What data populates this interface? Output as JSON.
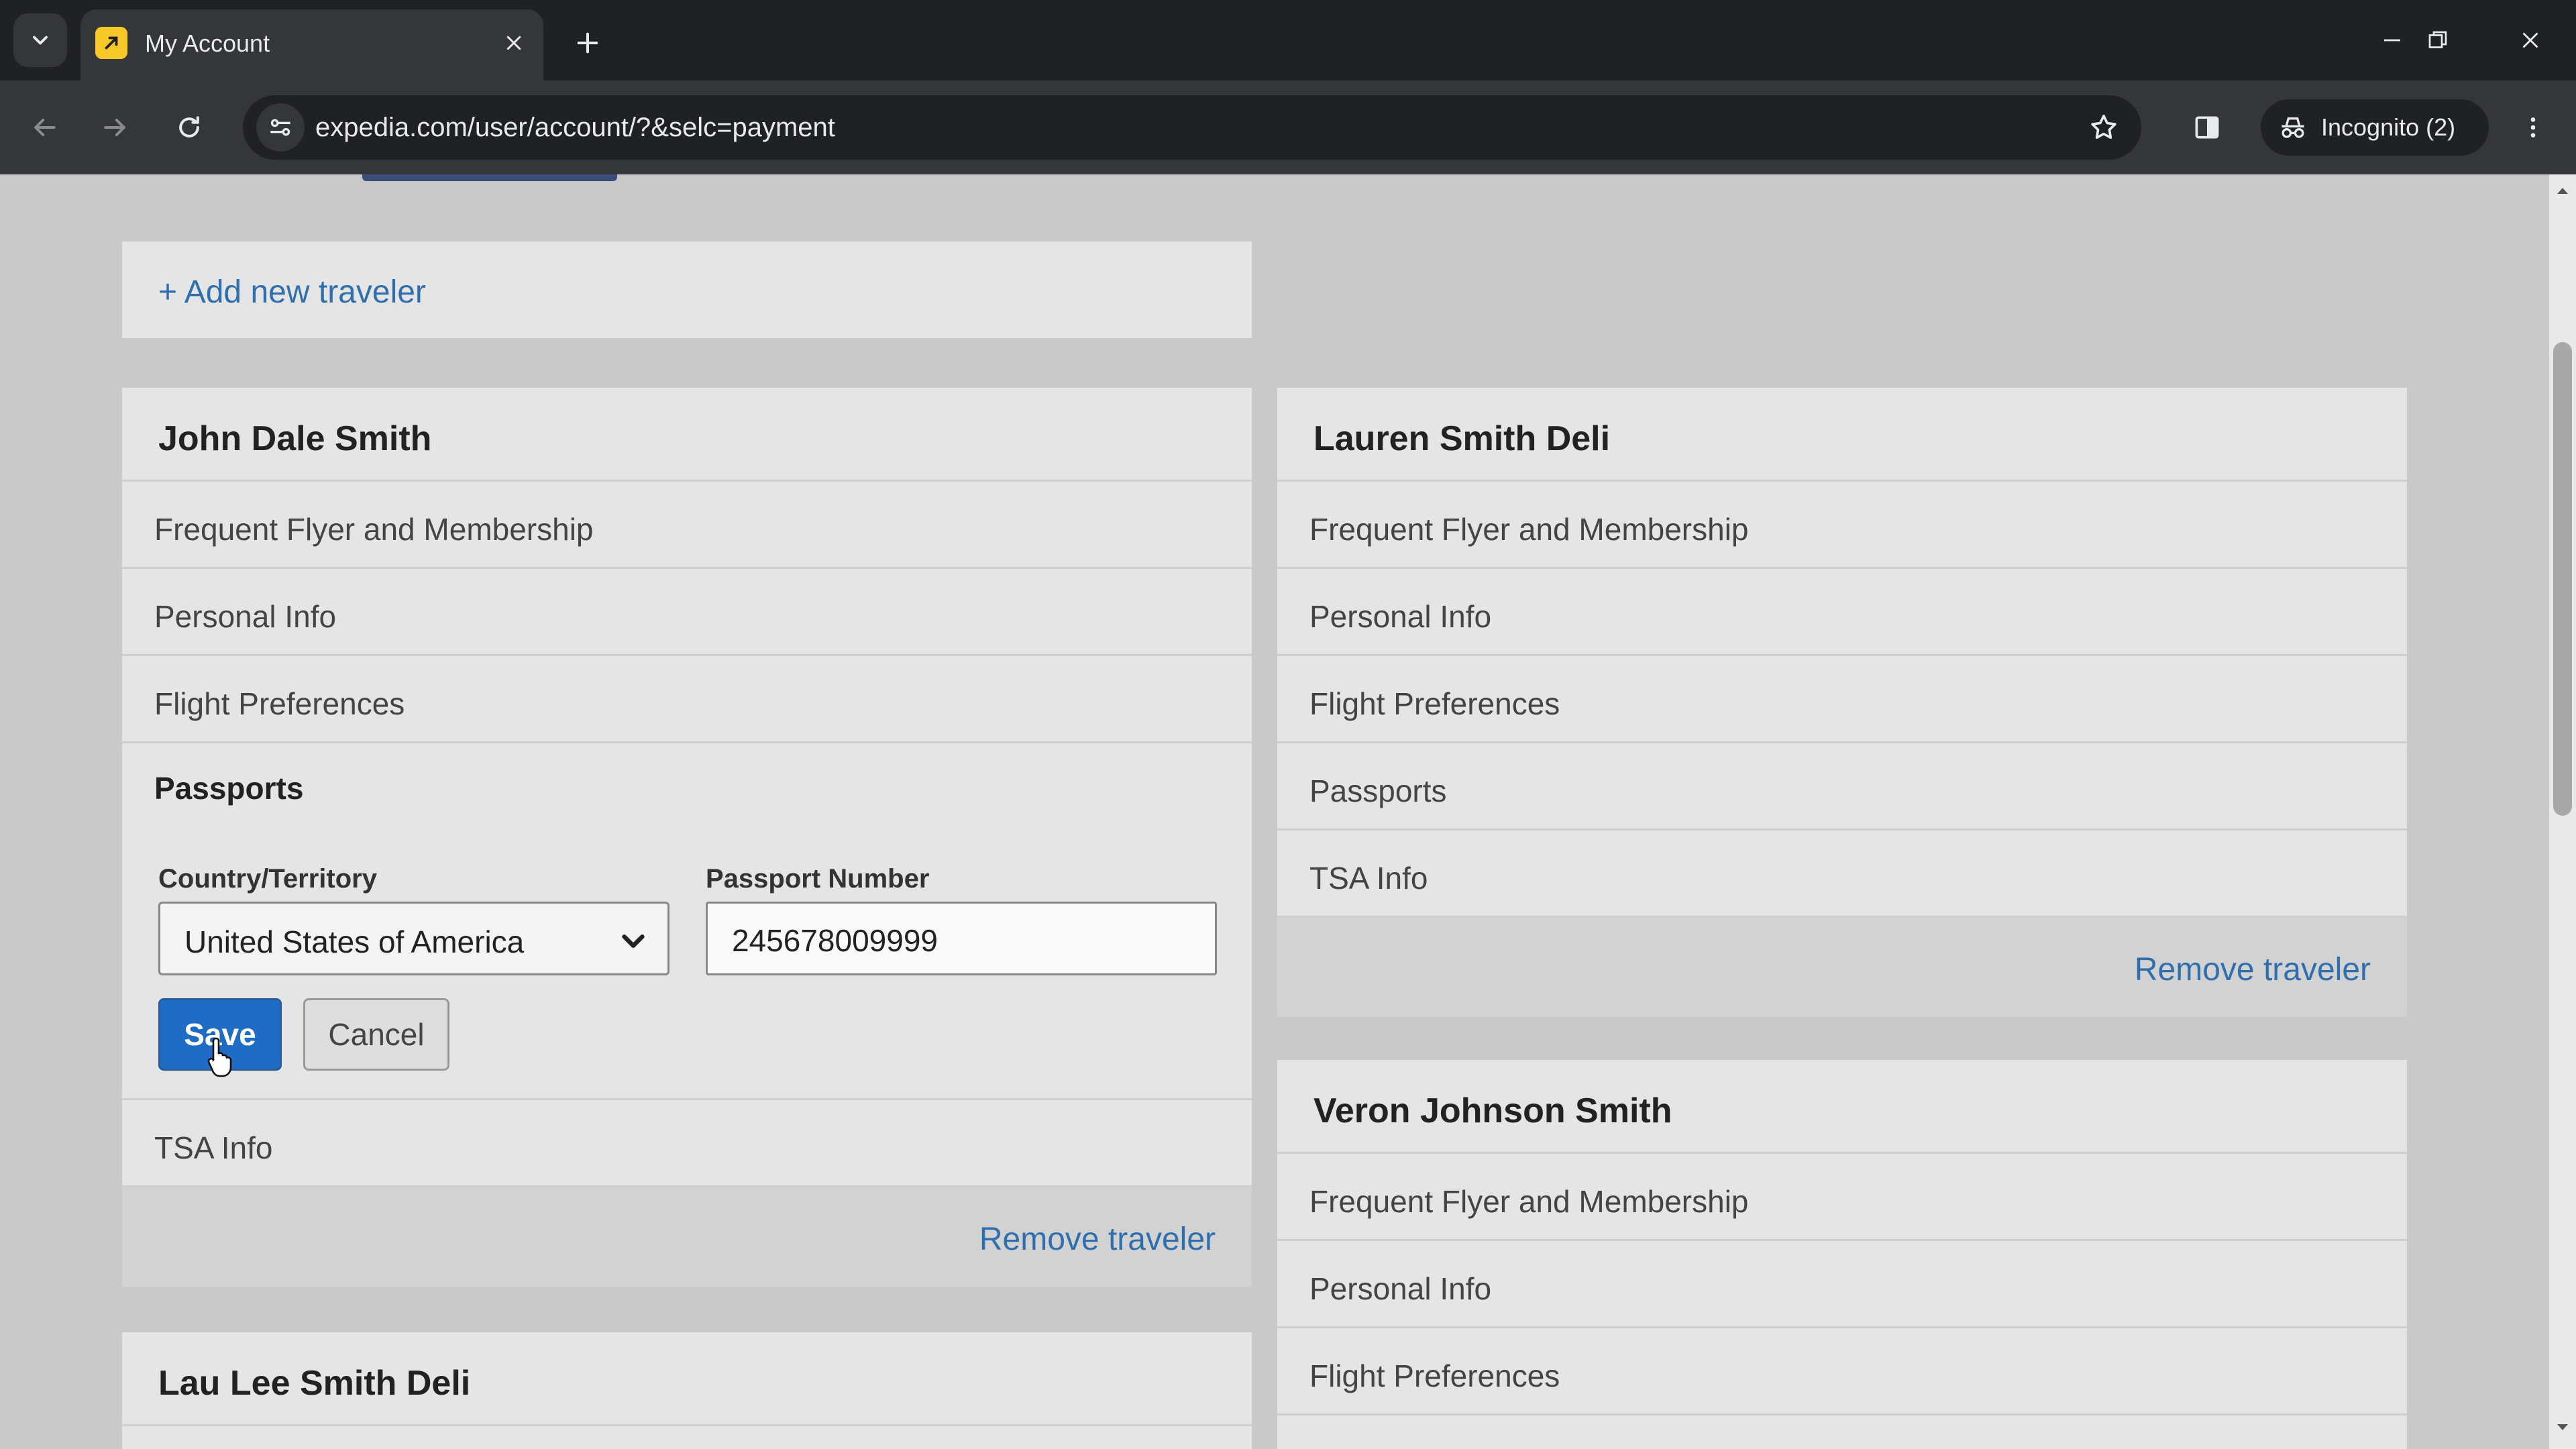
{
  "browser": {
    "tab_title": "My Account",
    "url": "expedia.com/user/account/?&selc=payment",
    "incognito_label": "Incognito (2)"
  },
  "page": {
    "add_traveler_label": "+ Add new traveler",
    "travelers": [
      {
        "name": "John Dale Smith",
        "sections": [
          "Frequent Flyer and Membership",
          "Personal Info",
          "Flight Preferences"
        ],
        "passport": {
          "title": "Passports",
          "country_label": "Country/Territory",
          "country_value": "United States of America",
          "number_label": "Passport Number",
          "number_value": "245678009999",
          "save_label": "Save",
          "cancel_label": "Cancel"
        },
        "after_sections": [
          "TSA Info"
        ],
        "remove_label": "Remove traveler"
      },
      {
        "name": "Lauren Smith Deli",
        "sections": [
          "Frequent Flyer and Membership",
          "Personal Info",
          "Flight Preferences",
          "Passports",
          "TSA Info"
        ],
        "remove_label": "Remove traveler"
      },
      {
        "name": "Veron Johnson Smith",
        "sections": [
          "Frequent Flyer and Membership",
          "Personal Info",
          "Flight Preferences"
        ]
      },
      {
        "name": "Lau Lee Smith Deli"
      }
    ]
  },
  "colors": {
    "link": "#2f6fae",
    "save_button": "#1f6cc4",
    "page_bg": "#c9c9c9",
    "card_bg": "#e5e5e5"
  }
}
